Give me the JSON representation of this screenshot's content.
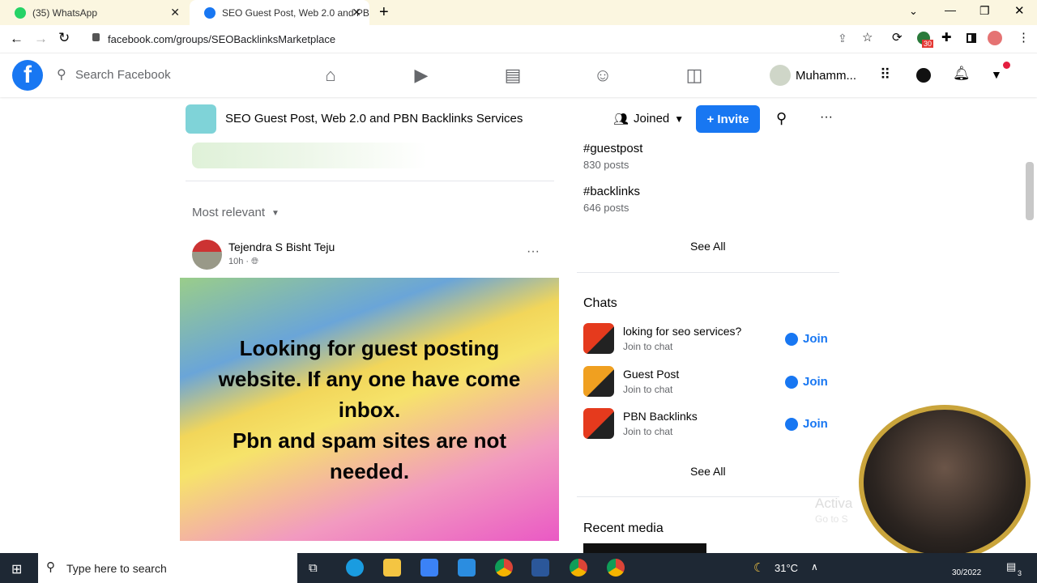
{
  "browser": {
    "tabs": [
      {
        "label": "(35) WhatsApp",
        "badge": "35",
        "active": false
      },
      {
        "label": "SEO Guest Post, Web 2.0 and PB",
        "active": true
      }
    ],
    "url": "facebook.com/groups/SEOBacklinksMarketplace",
    "extension_badge": "30"
  },
  "fb": {
    "search_placeholder": "Search Facebook",
    "user_name": "Muhamm..."
  },
  "group": {
    "title": "SEO Guest Post, Web 2.0 and PBN Backlinks Services",
    "joined_label": "Joined",
    "invite_label": "+ Invite"
  },
  "feed": {
    "sort_label": "Most relevant",
    "post": {
      "author": "Tejendra S Bisht Teju",
      "time": "10h ·",
      "image_text_1": "Looking for guest posting website. If any one have come inbox.",
      "image_text_2": "Pbn and spam sites are not needed."
    }
  },
  "sidebar": {
    "hashtags": [
      {
        "tag": "#guestpost",
        "count": "830 posts"
      },
      {
        "tag": "#backlinks",
        "count": "646 posts"
      }
    ],
    "see_all": "See All",
    "chats_title": "Chats",
    "chats": [
      {
        "name": "loking for seo services?",
        "sub": "Join to chat",
        "action": "Join"
      },
      {
        "name": "Guest Post",
        "sub": "Join to chat",
        "action": "Join"
      },
      {
        "name": "PBN Backlinks",
        "sub": "Join to chat",
        "action": "Join"
      }
    ],
    "chats_see_all": "See All",
    "recent_media_title": "Recent media"
  },
  "taskbar": {
    "search_placeholder": "Type here to search",
    "weather": "31°C",
    "date": "30/2022",
    "notifications": "3"
  },
  "overlay": {
    "watermark": "Activa",
    "watermark_sub": "Go to S"
  }
}
